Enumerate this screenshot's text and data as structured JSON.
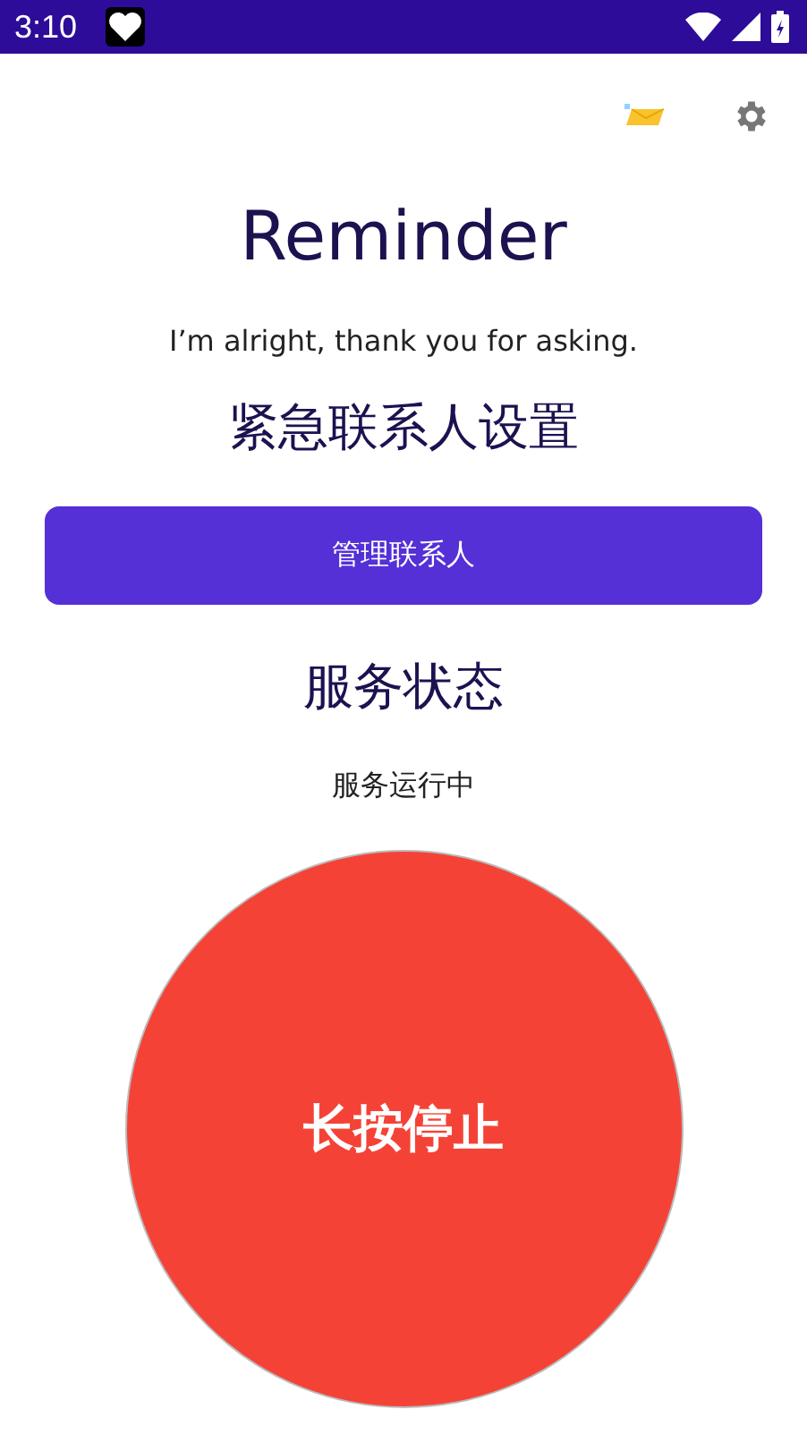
{
  "status_bar": {
    "time": "3:10"
  },
  "title": "Reminder",
  "greeting": "I’m alright, thank you for asking.",
  "contacts_heading": "紧急联系人设置",
  "manage_button": "管理联系人",
  "service_heading": "服务状态",
  "service_status": "服务运行中",
  "stop_button": "长按停止"
}
